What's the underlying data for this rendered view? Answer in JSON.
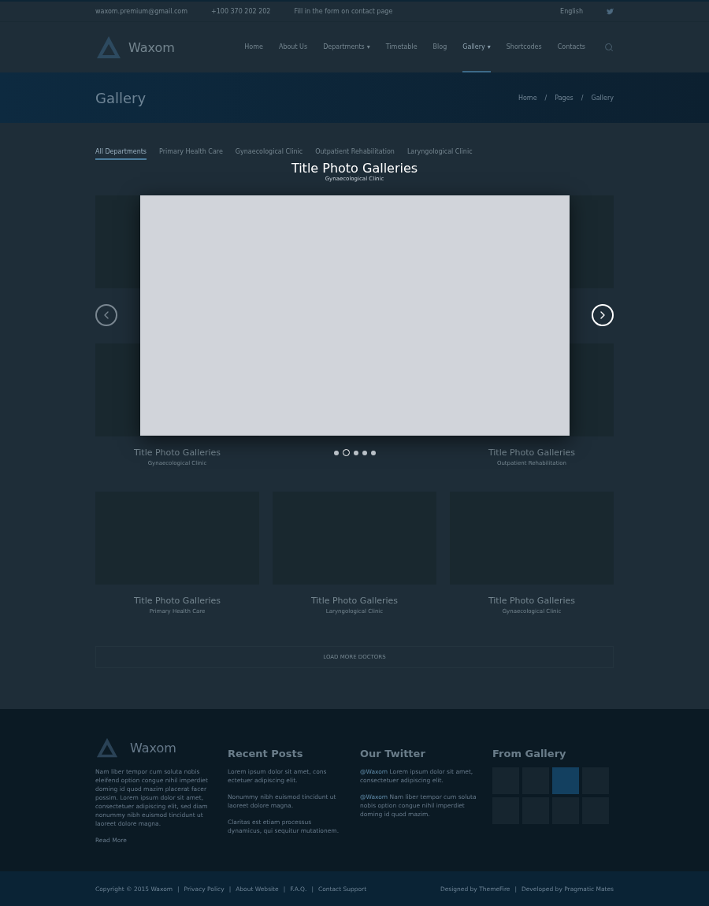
{
  "topbar": {
    "email": "waxom.premium@gmail.com",
    "phone": "+100 370 202 202",
    "contact": "Fill in the form on contact page",
    "language": "English"
  },
  "header": {
    "logo": "Waxom",
    "nav": [
      {
        "label": "Home",
        "selected": false
      },
      {
        "label": "About Us",
        "selected": false
      },
      {
        "label": "Departments",
        "selected": false,
        "caret": "▾"
      },
      {
        "label": "Timetable",
        "selected": false
      },
      {
        "label": "Blog",
        "selected": false
      },
      {
        "label": "Gallery",
        "selected": true,
        "caret": "▾"
      },
      {
        "label": "Shortcodes",
        "selected": false
      },
      {
        "label": "Contacts",
        "selected": false
      }
    ]
  },
  "page_title": {
    "title": "Gallery",
    "breadcrumbs": {
      "separator": "/",
      "items": [
        "Home",
        "Pages",
        "Gallery"
      ]
    }
  },
  "filters": [
    {
      "label": "All Departments",
      "selected": true
    },
    {
      "label": "Primary Health Care",
      "selected": false
    },
    {
      "label": "Gynaecological Clinic",
      "selected": false
    },
    {
      "label": "Outpatient Rehabilitation",
      "selected": false
    },
    {
      "label": "Laryngological Clinic",
      "selected": false
    }
  ],
  "gallery": [
    {
      "kind": "photo"
    },
    {
      "kind": "spacer"
    },
    {
      "kind": "photo"
    },
    {
      "kind": "photo",
      "title": "Title Photo Galleries",
      "subtitle": "Gynaecological Clinic"
    },
    {
      "kind": "spacer"
    },
    {
      "kind": "photo",
      "title": "Title Photo Galleries",
      "subtitle": "Outpatient Rehabilitation"
    },
    {
      "kind": "photo",
      "title": "Title Photo Galleries",
      "subtitle": "Primary Health Care"
    },
    {
      "kind": "photo",
      "title": "Title Photo Galleries",
      "subtitle": "Laryngological Clinic"
    },
    {
      "kind": "photo",
      "title": "Title Photo Galleries",
      "subtitle": "Gynaecological Clinic"
    }
  ],
  "load_more": "LOAD MORE DOCTORS",
  "lightbox": {
    "title": "Title Photo Galleries",
    "subtitle": "Gynaecological Clinic",
    "dots": [
      {
        "selected": false
      },
      {
        "selected": true
      },
      {
        "selected": false
      },
      {
        "selected": false
      },
      {
        "selected": false
      }
    ]
  },
  "footer": {
    "logo": "Waxom",
    "about": "Nam liber tempor cum soluta nobis eleifend option congue nihil imperdiet doming id quod mazim placerat facer possim. Lorem ipsum dolor sit amet, consectetuer adipiscing elit, sed diam nonummy nibh euismod tincidunt ut laoreet dolore magna.",
    "read_more": "Read More",
    "recent_posts": {
      "title": "Recent Posts",
      "posts": [
        "Lorem ipsum dolor sit amet, cons ectetuer adipiscing elit.",
        "Nonummy nibh euismod tincidunt ut laoreet dolore magna.",
        "Claritas est etiam processus dynamicus, qui sequitur mutationem."
      ]
    },
    "twitter": {
      "title": "Our Twitter",
      "tweets": [
        {
          "handle": "@Waxom",
          "text": "Lorem ipsum dolor sit amet, consectetuer adipiscing elit."
        },
        {
          "handle": "@Waxom",
          "text": "Nam liber tempor cum soluta nobis option congue nihil imperdiet doming id quod mazim."
        }
      ]
    },
    "gallery": {
      "title": "From Gallery",
      "thumbs": [
        {
          "selected": false
        },
        {
          "selected": false
        },
        {
          "selected": true
        },
        {
          "selected": false
        },
        {
          "selected": false
        },
        {
          "selected": false
        },
        {
          "selected": false
        },
        {
          "selected": false
        }
      ]
    }
  },
  "bottom": {
    "separator": "|",
    "links": [
      "Copyright © 2015 Waxom",
      "Privacy Policy",
      "About Website",
      "F.A.Q.",
      "Contact Support"
    ],
    "credits": [
      "Designed by ThemeFire",
      "Developed by Pragmatic Mates"
    ]
  }
}
